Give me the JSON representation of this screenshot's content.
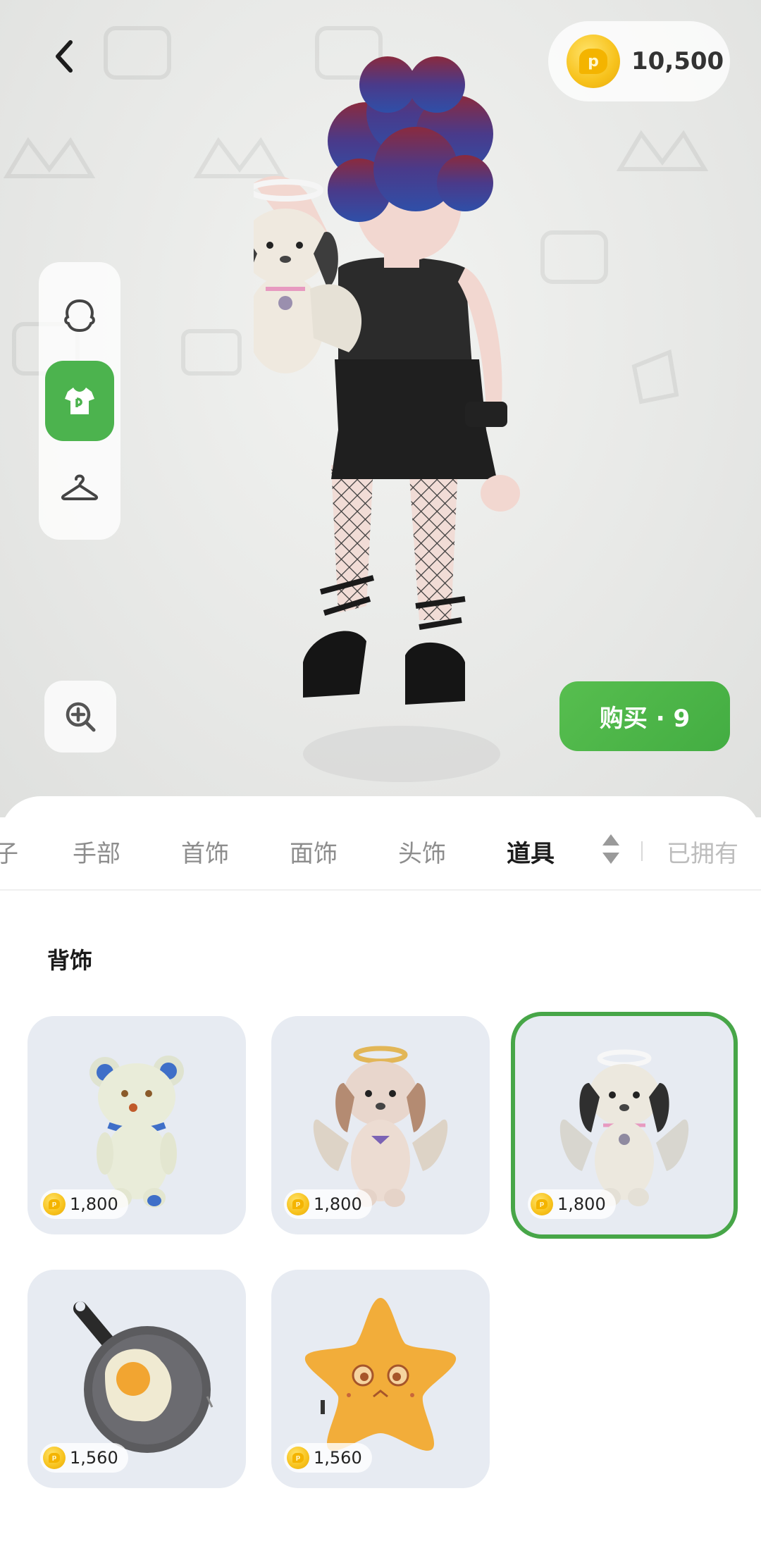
{
  "header": {
    "balance": "10,500"
  },
  "side_rail": {
    "items": [
      {
        "icon": "face-icon",
        "active": false
      },
      {
        "icon": "shirt-icon",
        "active": true
      },
      {
        "icon": "hanger-icon",
        "active": false
      }
    ]
  },
  "actions": {
    "buy_label": "购买 · 9"
  },
  "tabs": {
    "items": [
      "子",
      "手部",
      "首饰",
      "面饰",
      "头饰",
      "道具"
    ],
    "active": "道具",
    "owned_label": "已拥有"
  },
  "section": {
    "title": "背饰"
  },
  "items": [
    {
      "name": "bear-backpack",
      "price": "1,800",
      "selected": false
    },
    {
      "name": "angel-puppy-brown-backpack",
      "price": "1,800",
      "selected": false
    },
    {
      "name": "angel-puppy-black-backpack",
      "price": "1,800",
      "selected": true
    },
    {
      "name": "frying-pan-egg-backpack",
      "price": "1,560",
      "selected": false
    },
    {
      "name": "star-backpack",
      "price": "1,560",
      "selected": false
    }
  ],
  "colors": {
    "accent": "#4cb34e",
    "card_bg": "#e7ebf2",
    "coin": "#f7c21c"
  }
}
